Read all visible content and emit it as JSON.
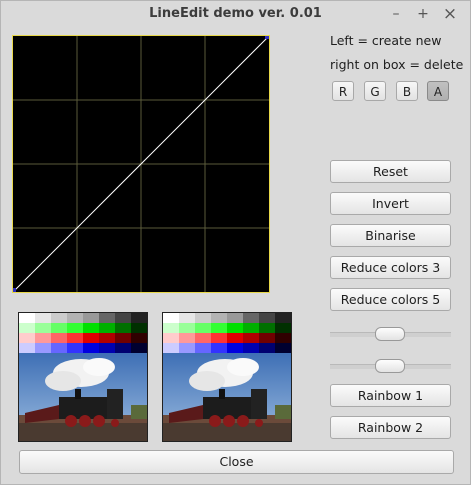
{
  "window": {
    "title": "LineEdit demo ver. 0.01",
    "minimize": "–",
    "maximize": "+",
    "close": "×"
  },
  "info": {
    "line1": "Left = create new",
    "line2": "right on box = delete"
  },
  "channels": [
    {
      "label": "R",
      "active": false
    },
    {
      "label": "G",
      "active": false
    },
    {
      "label": "B",
      "active": false
    },
    {
      "label": "A",
      "active": true
    }
  ],
  "buttons": {
    "reset": "Reset",
    "invert": "Invert",
    "binarise": "Binarise",
    "reduce3": "Reduce colors 3",
    "reduce5": "Reduce colors 5",
    "rainbow1": "Rainbow 1",
    "rainbow2": "Rainbow 2",
    "close": "Close"
  },
  "sliders": [
    {
      "value": 0.5
    },
    {
      "value": 0.5
    }
  ],
  "colors": {
    "curve_border": "#e8d84a",
    "grid": "#5a5a3a",
    "curve": "#ffffff",
    "control_point": "#3030c0"
  }
}
